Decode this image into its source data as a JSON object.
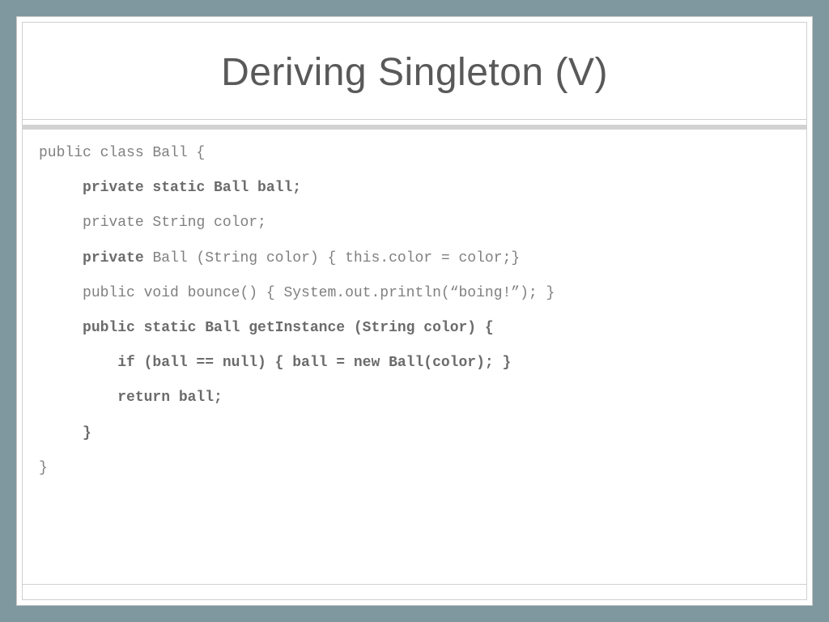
{
  "title": "Deriving Singleton (V)",
  "code": {
    "l1": "public class Ball {",
    "l2_b": "private static Ball ball;",
    "l3": "private String color;",
    "l4_b": "private",
    "l4_r": " Ball (String color) { this.color = color;}",
    "l5": "public void bounce() { System.out.println(“boing!”); }",
    "l6_b": "public static Ball getInstance (String color) {",
    "l7_b": "if (ball == null) { ball = new Ball(color); }",
    "l8_b": "return ball;",
    "l9_b": "}",
    "l10": "}"
  }
}
